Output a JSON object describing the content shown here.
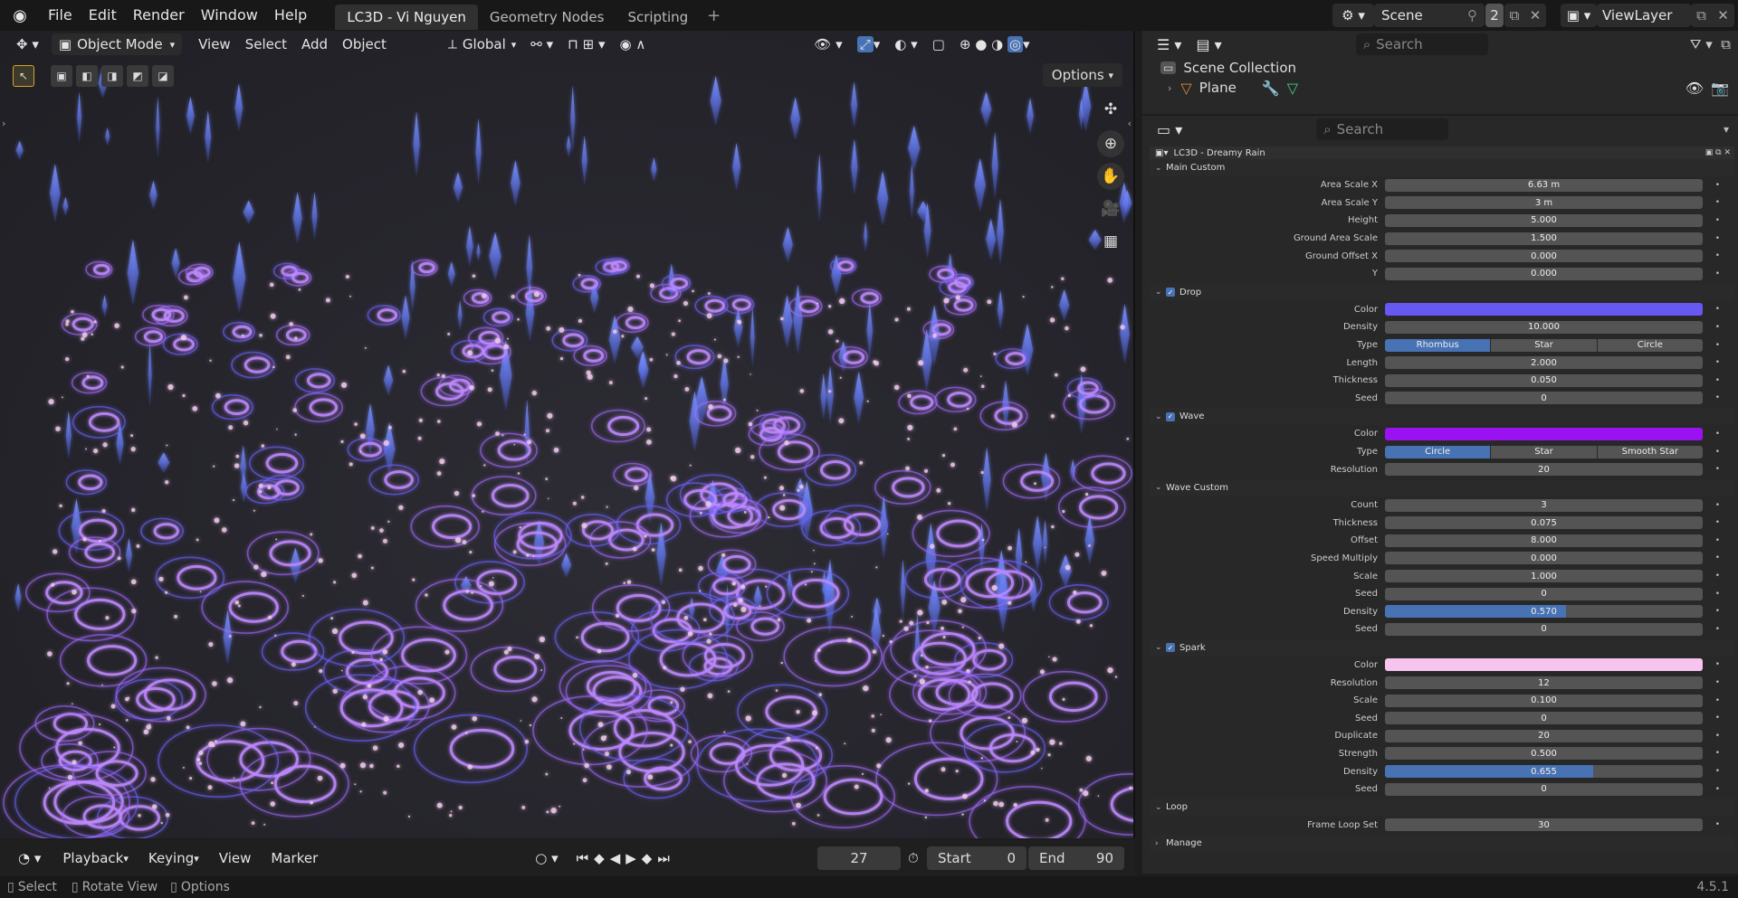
{
  "topbar": {
    "menus": [
      "File",
      "Edit",
      "Render",
      "Window",
      "Help"
    ],
    "workspaces": [
      "LC3D - Vi Nguyen",
      "Geometry Nodes",
      "Scripting"
    ],
    "active_workspace": 0,
    "add_workspace": "+",
    "scene": "Scene",
    "scene_users": "2",
    "view_layer": "ViewLayer"
  },
  "viewport": {
    "mode": "Object Mode",
    "menus": [
      "View",
      "Select",
      "Add",
      "Object"
    ],
    "transform": "Global",
    "options": "Options"
  },
  "timeline": {
    "menus": [
      "Playback",
      "Keying",
      "View",
      "Marker"
    ],
    "frame": "27",
    "start_label": "Start",
    "start": "0",
    "end_label": "End",
    "end": "90"
  },
  "statusbar": {
    "select": "Select",
    "rotate": "Rotate View",
    "options": "Options",
    "version": "4.5.1"
  },
  "outliner": {
    "search_placeholder": "Search",
    "collection": "Scene Collection",
    "object": "Plane"
  },
  "properties": {
    "search_placeholder": "Search",
    "panel_title": "LC3D - Dreamy Rain",
    "sections": [
      {
        "title": "Main Custom",
        "checkbox": false,
        "rows": [
          {
            "label": "Area Scale X",
            "value": "6.63 m"
          },
          {
            "label": "Area Scale Y",
            "value": "3 m"
          },
          {
            "label": "Height",
            "value": "5.000"
          },
          {
            "label": "Ground Area Scale",
            "value": "1.500"
          },
          {
            "label": "Ground Offset X",
            "value": "0.000"
          },
          {
            "label": "Y",
            "value": "0.000"
          }
        ]
      },
      {
        "title": "Drop",
        "checkbox": true,
        "rows": [
          {
            "label": "Color",
            "color": "#6658f0"
          },
          {
            "label": "Density",
            "value": "10.000"
          },
          {
            "label": "Type",
            "options": [
              "Rhombus",
              "Star",
              "Circle"
            ],
            "selected": 0
          },
          {
            "label": "Length",
            "value": "2.000"
          },
          {
            "label": "Thickness",
            "value": "0.050"
          },
          {
            "label": "Seed",
            "value": "0"
          }
        ]
      },
      {
        "title": "Wave",
        "checkbox": true,
        "rows": [
          {
            "label": "Color",
            "color": "#9a12f2"
          },
          {
            "label": "Type",
            "options": [
              "Circle",
              "Star",
              "Smooth Star"
            ],
            "selected": 0
          },
          {
            "label": "Resolution",
            "value": "20"
          }
        ]
      },
      {
        "title": "Wave Custom",
        "checkbox": false,
        "rows": [
          {
            "label": "Count",
            "value": "3"
          },
          {
            "label": "Thickness",
            "value": "0.075"
          },
          {
            "label": "Offset",
            "value": "8.000"
          },
          {
            "label": "Speed Multiply",
            "value": "0.000"
          },
          {
            "label": "Scale",
            "value": "1.000"
          },
          {
            "label": "Seed",
            "value": "0"
          },
          {
            "label": "Density",
            "value": "0.570",
            "fill": 0.57
          },
          {
            "label": "Seed",
            "value": "0"
          }
        ]
      },
      {
        "title": "Spark",
        "checkbox": true,
        "rows": [
          {
            "label": "Color",
            "color": "#f6c4ef"
          },
          {
            "label": "Resolution",
            "value": "12"
          },
          {
            "label": "Scale",
            "value": "0.100"
          },
          {
            "label": "Seed",
            "value": "0"
          },
          {
            "label": "Duplicate",
            "value": "20"
          },
          {
            "label": "Strength",
            "value": "0.500"
          },
          {
            "label": "Density",
            "value": "0.655",
            "fill": 0.655
          },
          {
            "label": "Seed",
            "value": "0"
          }
        ]
      },
      {
        "title": "Loop",
        "checkbox": false,
        "rows": [
          {
            "label": "Frame Loop Set",
            "value": "30"
          }
        ]
      },
      {
        "title": "Manage",
        "checkbox": false,
        "collapsed": true,
        "rows": []
      }
    ]
  },
  "colors": {
    "accent": "#4772b3",
    "wave": "#a060ff",
    "drop": "#5a78ff",
    "spark": "#f0c8f0"
  }
}
